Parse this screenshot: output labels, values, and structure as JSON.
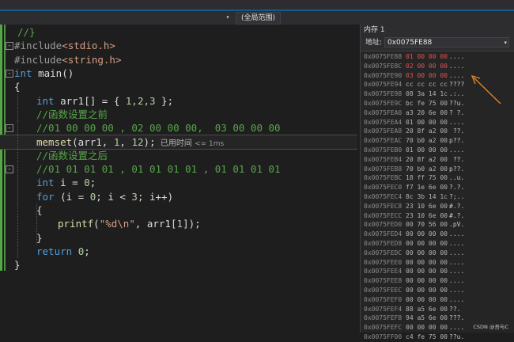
{
  "toolbar": {
    "scope_label": "(全局范围)",
    "dropdown_glyph": "▾"
  },
  "code_lines": [
    {
      "parts": [
        {
          "t": "//}",
          "c": "c-cm"
        }
      ]
    },
    {
      "parts": [
        {
          "t": "#include",
          "c": "c-pp"
        },
        {
          "t": "<stdio.h>",
          "c": "c-str"
        }
      ]
    },
    {
      "parts": [
        {
          "t": "#include",
          "c": "c-pp"
        },
        {
          "t": "<string.h>",
          "c": "c-str"
        }
      ]
    },
    {
      "parts": [
        {
          "t": "int",
          "c": "c-kw"
        },
        {
          "t": " main()",
          "c": ""
        }
      ]
    },
    {
      "parts": [
        {
          "t": "{",
          "c": ""
        }
      ]
    },
    {
      "parts": [
        {
          "t": "int",
          "c": "c-kw"
        },
        {
          "t": " arr1[] = { ",
          "c": ""
        },
        {
          "t": "1,2,3",
          "c": "c-num"
        },
        {
          "t": " };",
          "c": ""
        }
      ]
    },
    {
      "parts": [
        {
          "t": "//函数设置之前",
          "c": "c-cm"
        }
      ]
    },
    {
      "parts": [
        {
          "t": "//01 00 00 00 , 02 00 00 00,  03 00 00 00",
          "c": "c-cm"
        }
      ]
    },
    {
      "parts": [
        {
          "t": "memset",
          "c": "c-fn"
        },
        {
          "t": "(arr1, ",
          "c": ""
        },
        {
          "t": "1",
          "c": "c-num"
        },
        {
          "t": ", ",
          "c": ""
        },
        {
          "t": "12",
          "c": "c-num"
        },
        {
          "t": ");",
          "c": ""
        }
      ]
    },
    {
      "parts": [
        {
          "t": "//函数设置之后",
          "c": "c-cm"
        }
      ]
    },
    {
      "parts": [
        {
          "t": "//01 01 01 01 , 01 01 01 01 , 01 01 01 01",
          "c": "c-cm"
        }
      ]
    },
    {
      "parts": [
        {
          "t": "int",
          "c": "c-kw"
        },
        {
          "t": " i = ",
          "c": ""
        },
        {
          "t": "0",
          "c": "c-num"
        },
        {
          "t": ";",
          "c": ""
        }
      ]
    },
    {
      "parts": [
        {
          "t": "for",
          "c": "c-kw"
        },
        {
          "t": " (i = ",
          "c": ""
        },
        {
          "t": "0",
          "c": "c-num"
        },
        {
          "t": "; i < ",
          "c": ""
        },
        {
          "t": "3",
          "c": "c-num"
        },
        {
          "t": "; i++)",
          "c": ""
        }
      ]
    },
    {
      "parts": [
        {
          "t": "{",
          "c": ""
        }
      ]
    },
    {
      "parts": [
        {
          "t": "printf",
          "c": "c-fn"
        },
        {
          "t": "(",
          "c": ""
        },
        {
          "t": "\"%d\\n\"",
          "c": "c-str"
        },
        {
          "t": ", arr1[",
          "c": ""
        },
        {
          "t": "1",
          "c": "c-num"
        },
        {
          "t": "]);",
          "c": ""
        }
      ]
    },
    {
      "parts": [
        {
          "t": "}",
          "c": ""
        }
      ]
    },
    {
      "parts": [
        {
          "t": "return",
          "c": "c-kw"
        },
        {
          "t": " ",
          "c": ""
        },
        {
          "t": "0",
          "c": "c-num"
        },
        {
          "t": ";",
          "c": ""
        }
      ]
    },
    {
      "parts": [
        {
          "t": "}",
          "c": ""
        }
      ]
    }
  ],
  "elapsed_hint": {
    "label": "已用时间",
    "value": "<= 1ms"
  },
  "memory": {
    "title": "内存 1",
    "address_label": "地址:",
    "address_value": "0x0075FE88",
    "rows": [
      {
        "addr": "0x0075FE88",
        "bytes": "01 00 00 00",
        "ascii": "....",
        "changed": true
      },
      {
        "addr": "0x0075FE8C",
        "bytes": "02 00 00 00",
        "ascii": "....",
        "changed": true
      },
      {
        "addr": "0x0075FE90",
        "bytes": "03 00 00 00",
        "ascii": "....",
        "changed": true
      },
      {
        "addr": "0x0075FE94",
        "bytes": "cc cc cc cc",
        "ascii": "????",
        "changed": false
      },
      {
        "addr": "0x0075FE98",
        "bytes": "08 3a 14 1c",
        "ascii": ".:..",
        "changed": false
      },
      {
        "addr": "0x0075FE9C",
        "bytes": "bc fe 75 00",
        "ascii": "??u.",
        "changed": false
      },
      {
        "addr": "0x0075FEA0",
        "bytes": "a3 20 6e 00",
        "ascii": "? ?.",
        "changed": false
      },
      {
        "addr": "0x0075FEA4",
        "bytes": "01 00 00 00",
        "ascii": "....",
        "changed": false
      },
      {
        "addr": "0x0075FEA8",
        "bytes": "20 8f a2 00",
        "ascii": " ??.",
        "changed": false
      },
      {
        "addr": "0x0075FEAC",
        "bytes": "70 b0 a2 00",
        "ascii": "p??.",
        "changed": false
      },
      {
        "addr": "0x0075FEB0",
        "bytes": "01 00 00 00",
        "ascii": "....",
        "changed": false
      },
      {
        "addr": "0x0075FEB4",
        "bytes": "20 8f a2 00",
        "ascii": " ??.",
        "changed": false
      },
      {
        "addr": "0x0075FEB8",
        "bytes": "70 b0 a2 00",
        "ascii": "p??.",
        "changed": false
      },
      {
        "addr": "0x0075FEBC",
        "bytes": "18 ff 75 00",
        "ascii": "..u.",
        "changed": false
      },
      {
        "addr": "0x0075FEC0",
        "bytes": "f7 1e 6e 00",
        "ascii": "?.?.",
        "changed": false
      },
      {
        "addr": "0x0075FEC4",
        "bytes": "8c 3b 14 1c",
        "ascii": "?;..",
        "changed": false
      },
      {
        "addr": "0x0075FEC8",
        "bytes": "23 10 6e 00",
        "ascii": "#.?.",
        "changed": false
      },
      {
        "addr": "0x0075FECC",
        "bytes": "23 10 6e 00",
        "ascii": "#.?.",
        "changed": false
      },
      {
        "addr": "0x0075FED0",
        "bytes": "00 70 56 00",
        "ascii": ".pV.",
        "changed": false
      },
      {
        "addr": "0x0075FED4",
        "bytes": "00 00 00 00",
        "ascii": "....",
        "changed": false
      },
      {
        "addr": "0x0075FED8",
        "bytes": "00 00 00 00",
        "ascii": "....",
        "changed": false
      },
      {
        "addr": "0x0075FEDC",
        "bytes": "00 00 00 00",
        "ascii": "....",
        "changed": false
      },
      {
        "addr": "0x0075FEE0",
        "bytes": "00 00 00 00",
        "ascii": "....",
        "changed": false
      },
      {
        "addr": "0x0075FEE4",
        "bytes": "00 00 00 00",
        "ascii": "....",
        "changed": false
      },
      {
        "addr": "0x0075FEE8",
        "bytes": "00 00 00 00",
        "ascii": "....",
        "changed": false
      },
      {
        "addr": "0x0075FEEC",
        "bytes": "00 00 00 00",
        "ascii": "....",
        "changed": false
      },
      {
        "addr": "0x0075FEF0",
        "bytes": "00 00 00 00",
        "ascii": "....",
        "changed": false
      },
      {
        "addr": "0x0075FEF4",
        "bytes": "88 a5 6e 00",
        "ascii": "??.",
        "changed": false
      },
      {
        "addr": "0x0075FEF8",
        "bytes": "94 a5 6e 00",
        "ascii": "???.",
        "changed": false
      },
      {
        "addr": "0x0075FEFC",
        "bytes": "00 00 00 00",
        "ascii": "....",
        "changed": false
      },
      {
        "addr": "0x0075FF00",
        "bytes": "c4 fe 75 00",
        "ascii": "??u.",
        "changed": false
      }
    ]
  },
  "watermark": "CSDN @吾与C",
  "colors": {
    "changed_byte": "#e05252",
    "arrow": "#e0802a",
    "green_margin": "#57a64a"
  }
}
